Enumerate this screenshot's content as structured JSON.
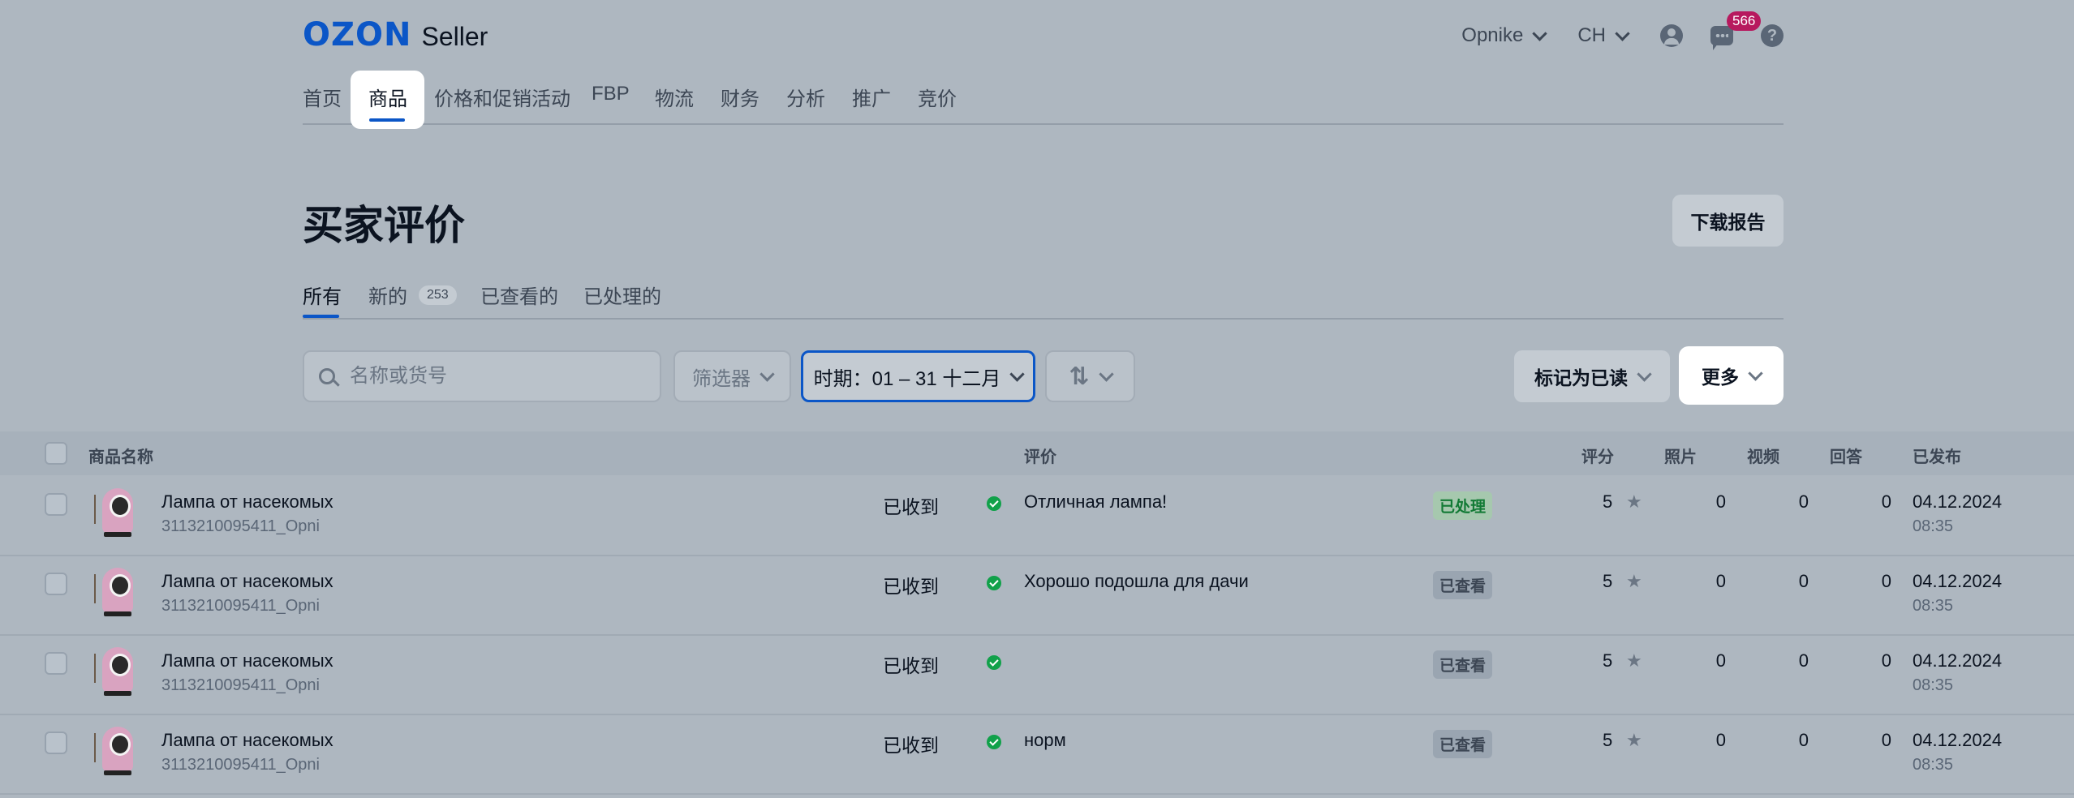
{
  "logo": {
    "brand": "OZON",
    "product": "Seller"
  },
  "topbar": {
    "company": "Opnike",
    "language": "CH",
    "chat_badge": "566",
    "help_symbol": "?"
  },
  "nav": {
    "items": [
      "首页",
      "价格和促销活动",
      "FBP",
      "物流",
      "财务",
      "分析",
      "推广",
      "竞价"
    ],
    "active": "商品"
  },
  "page": {
    "title": "买家评价",
    "download_label": "下载报告"
  },
  "tabs": [
    {
      "label": "所有"
    },
    {
      "label": "新的",
      "count": "253"
    },
    {
      "label": "已查看的"
    },
    {
      "label": "已处理的"
    }
  ],
  "filters": {
    "search_placeholder": "名称或货号",
    "filter_label": "筛选器",
    "period_label": "时期：01 – 31 十二月",
    "sort_symbol": "⇅",
    "mark_read_label": "标记为已读",
    "more_label": "更多"
  },
  "table": {
    "headers": {
      "product": "商品名称",
      "review": "评价",
      "rating": "评分",
      "photos": "照片",
      "videos": "视频",
      "answers": "回答",
      "published": "已发布"
    },
    "rows": [
      {
        "name": "Лампа от насекомых",
        "sku": "3113210095411_Opni",
        "received": "已收到",
        "review": "Отличная лампа!",
        "status": "已处理",
        "status_type": "processed",
        "rating": "5",
        "photos": "0",
        "videos": "0",
        "answers": "0",
        "date": "04.12.2024",
        "time": "08:35"
      },
      {
        "name": "Лампа от насекомых",
        "sku": "3113210095411_Opni",
        "received": "已收到",
        "review": "Хорошо подошла для дачи",
        "status": "已查看",
        "status_type": "viewed",
        "rating": "5",
        "photos": "0",
        "videos": "0",
        "answers": "0",
        "date": "04.12.2024",
        "time": "08:35"
      },
      {
        "name": "Лампа от насекомых",
        "sku": "3113210095411_Opni",
        "received": "已收到",
        "review": "",
        "status": "已查看",
        "status_type": "viewed",
        "rating": "5",
        "photos": "0",
        "videos": "0",
        "answers": "0",
        "date": "04.12.2024",
        "time": "08:35"
      },
      {
        "name": "Лампа от насекомых",
        "sku": "3113210095411_Opni",
        "received": "已收到",
        "review": "норм",
        "status": "已查看",
        "status_type": "viewed",
        "rating": "5",
        "photos": "0",
        "videos": "0",
        "answers": "0",
        "date": "04.12.2024",
        "time": "08:35"
      }
    ]
  },
  "colors": {
    "brand": "#0b56c7",
    "overlay_bg": "#aeb7c0",
    "badge": "#b7195e",
    "success": "#11a14a"
  }
}
